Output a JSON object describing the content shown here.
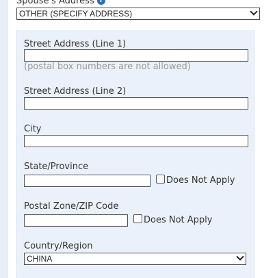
{
  "spouse_address": {
    "label": "Spouse's Address",
    "selected": "OTHER (SPECIFY ADDRESS)"
  },
  "fields": {
    "street1": {
      "label": "Street Address (Line 1)",
      "value": "",
      "hint": "(postal box numbers are not allowed)"
    },
    "street2": {
      "label": "Street Address (Line 2)",
      "value": ""
    },
    "city": {
      "label": "City",
      "value": ""
    },
    "state": {
      "label": "State/Province",
      "value": "",
      "na_label": "Does Not Apply",
      "na_checked": false
    },
    "postal": {
      "label": "Postal Zone/ZIP Code",
      "value": "",
      "na_label": "Does Not Apply",
      "na_checked": false
    },
    "country": {
      "label": "Country/Region",
      "selected": "CHINA"
    }
  },
  "icons": {
    "help": "info-icon"
  },
  "colors": {
    "page_bg": "#e7eef7",
    "panel_bg": "#eaf1fb",
    "help_icon": "#2b6cc4"
  }
}
